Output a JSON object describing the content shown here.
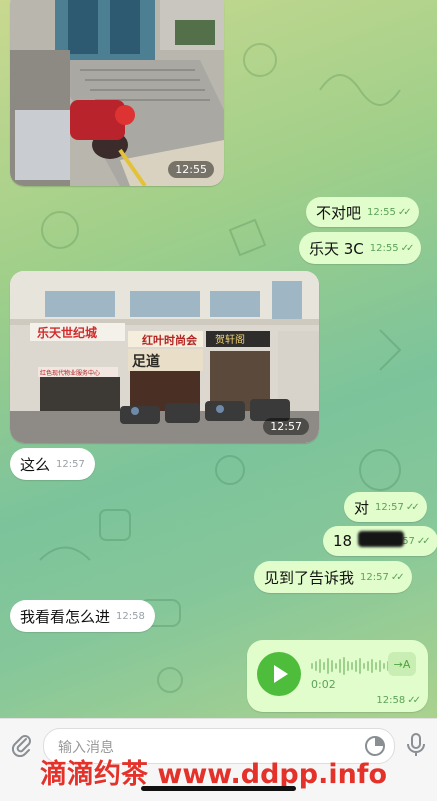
{
  "messages": [
    {
      "type": "photo_in",
      "time": "12:55"
    },
    {
      "type": "text_out",
      "text": "不对吧",
      "time": "12:55"
    },
    {
      "type": "text_out",
      "text": "乐天 3C",
      "time": "12:55"
    },
    {
      "type": "photo_in",
      "time": "12:57",
      "signs": [
        "乐天世纪城",
        "红叶时尚会",
        "足道",
        "贺轩阁",
        "红色现代物业服务中心"
      ]
    },
    {
      "type": "text_in",
      "text": "这么",
      "time": "12:57"
    },
    {
      "type": "text_out",
      "text": "对",
      "time": "12:57"
    },
    {
      "type": "text_out",
      "text": "18",
      "time": "12:57"
    },
    {
      "type": "text_out",
      "text": "见到了告诉我",
      "time": "12:57"
    },
    {
      "type": "text_in",
      "text": "我看看怎么进",
      "time": "12:58"
    },
    {
      "type": "voice_out",
      "duration": "0:02",
      "time": "12:58",
      "transcribe_label": "→A"
    }
  ],
  "input": {
    "placeholder": "输入消息"
  },
  "watermark": "滴滴约茶 www.ddpp.info",
  "colors": {
    "outgoing": "#e1fdcb",
    "incoming": "#ffffff",
    "play": "#4fbd3c",
    "watermark": "#e4322b"
  },
  "icons": [
    "attach-icon",
    "sticker-icon",
    "microphone-icon",
    "play-icon",
    "transcribe-icon",
    "double-check-icon"
  ]
}
